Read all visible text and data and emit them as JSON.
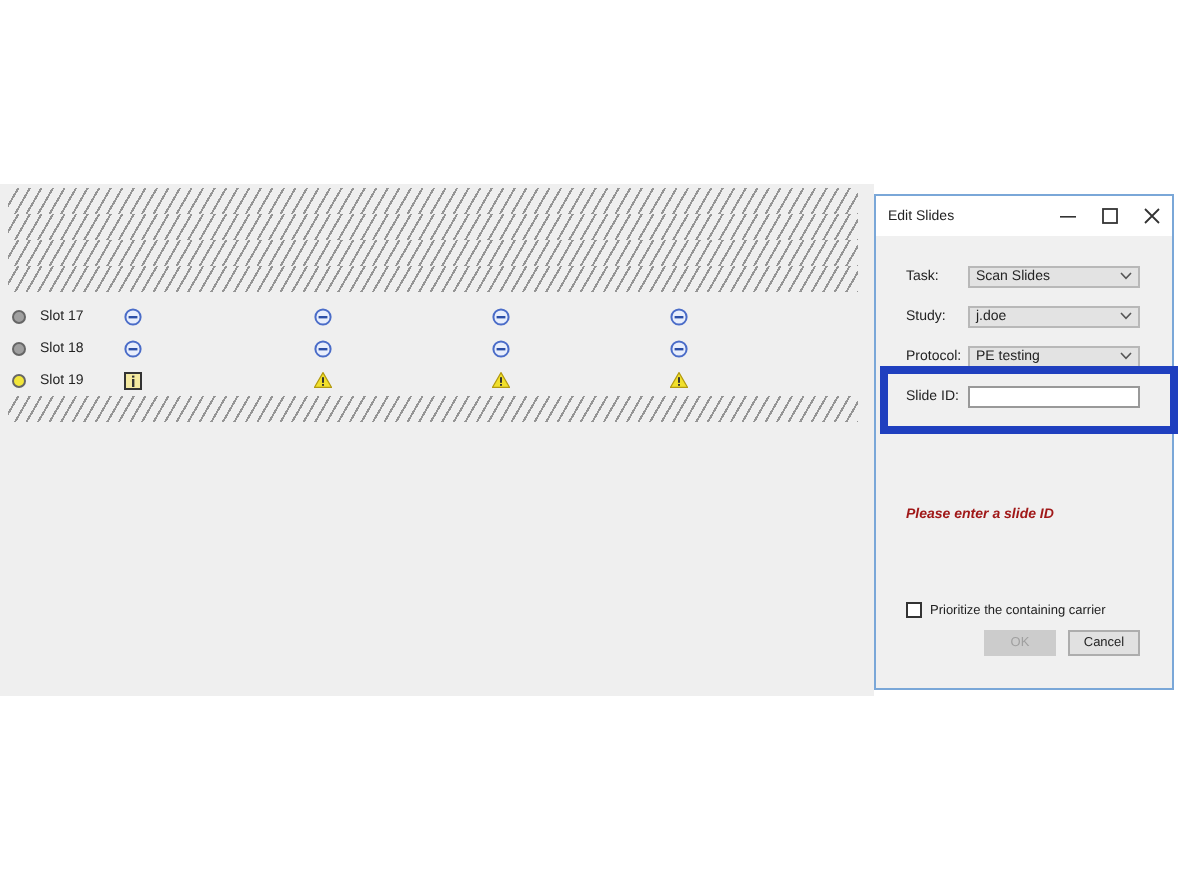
{
  "slots": [
    {
      "label": "Slot 17",
      "color": "#a0a0a0",
      "cells": [
        {
          "kind": "blocked"
        },
        {
          "kind": "blocked"
        },
        {
          "kind": "blocked"
        },
        {
          "kind": "blocked"
        }
      ]
    },
    {
      "label": "Slot 18",
      "color": "#a0a0a0",
      "cells": [
        {
          "kind": "blocked"
        },
        {
          "kind": "blocked"
        },
        {
          "kind": "blocked"
        },
        {
          "kind": "blocked"
        }
      ]
    },
    {
      "label": "Slot 19",
      "color": "#f2e63a",
      "cells": [
        {
          "kind": "info"
        },
        {
          "kind": "warning"
        },
        {
          "kind": "warning"
        },
        {
          "kind": "warning"
        }
      ]
    }
  ],
  "dialog": {
    "title": "Edit Slides",
    "fields": [
      {
        "label": "Task:",
        "value": "Scan Slides"
      },
      {
        "label": "Study:",
        "value": "j.doe"
      },
      {
        "label": "Protocol:",
        "value": "PE testing"
      }
    ],
    "slide_id": {
      "label": "Slide ID:"
    },
    "error": "Please enter a slide ID",
    "checkbox": {
      "label": "Prioritize the containing carrier",
      "checked": false
    },
    "buttons": [
      {
        "label": "OK",
        "disabled": true
      },
      {
        "label": "Cancel",
        "disabled": false
      }
    ]
  }
}
